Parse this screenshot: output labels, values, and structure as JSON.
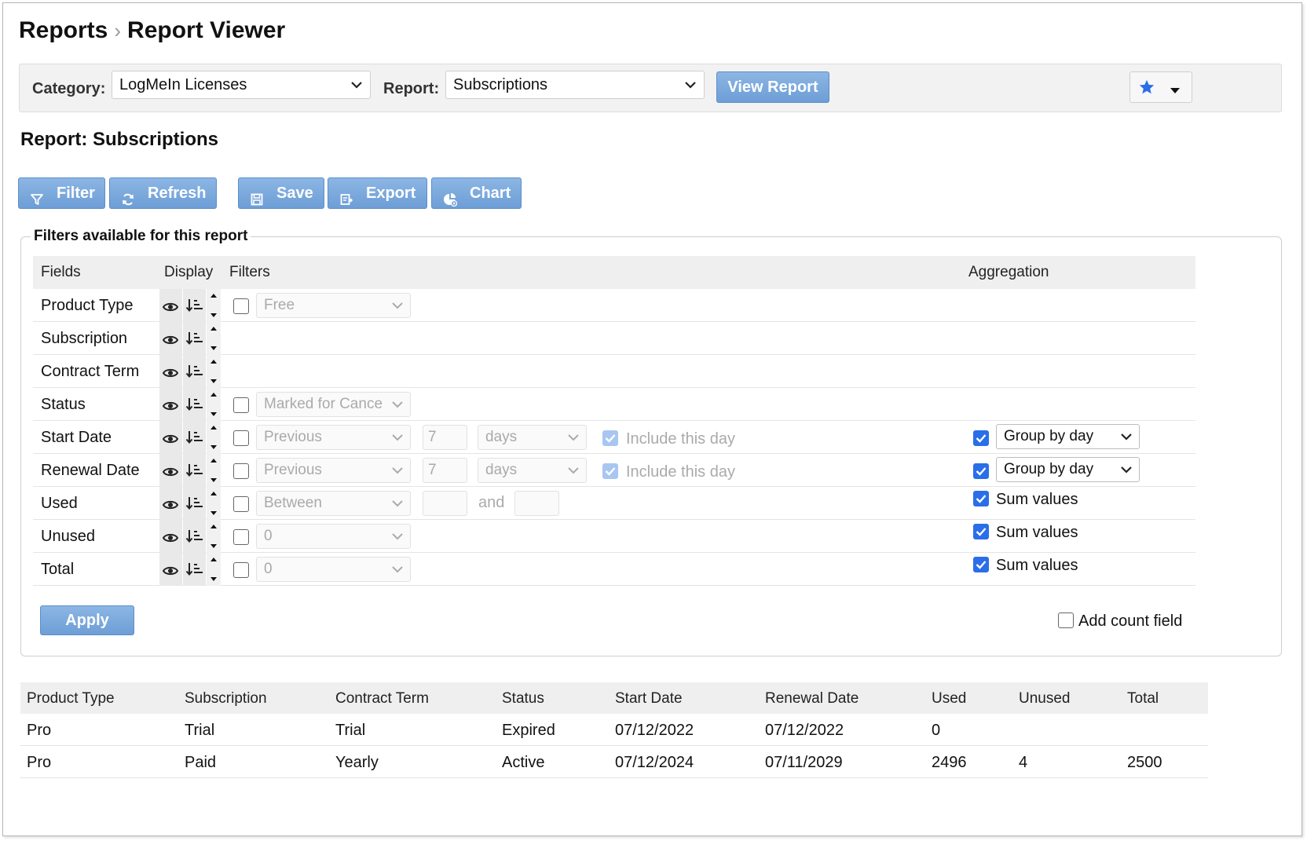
{
  "breadcrumb": {
    "parent": "Reports",
    "separator": "›",
    "current": "Report Viewer"
  },
  "toolbar": {
    "category_label": "Category:",
    "category_value": "LogMeIn Licenses",
    "report_label": "Report:",
    "report_value": "Subscriptions",
    "view_button": "View Report",
    "favorites_icon": "star-icon",
    "accent_color": "#2a6ee8"
  },
  "report_title": "Report: Subscriptions",
  "actions": [
    {
      "label": "Filter",
      "icon": "filter-icon"
    },
    {
      "label": "Refresh",
      "icon": "refresh-icon"
    },
    {
      "label": "Save",
      "icon": "save-icon"
    },
    {
      "label": "Export",
      "icon": "export-icon"
    },
    {
      "label": "Chart",
      "icon": "chart-icon"
    }
  ],
  "filters": {
    "legend": "Filters available for this report",
    "headers": {
      "fields": "Fields",
      "display": "Display",
      "filters": "Filters",
      "aggregation": "Aggregation"
    },
    "rows": [
      {
        "field": "Product Type",
        "filter_value": "Free"
      },
      {
        "field": "Subscription"
      },
      {
        "field": "Contract Term"
      },
      {
        "field": "Status",
        "filter_value": "Marked for Cance"
      },
      {
        "field": "Start Date",
        "filter_value": "Previous",
        "amount": "7",
        "unit": "days",
        "include_label": "Include this day",
        "include_checked": true,
        "aggregation_checked": true,
        "aggregation_value": "Group by day"
      },
      {
        "field": "Renewal Date",
        "filter_value": "Previous",
        "amount": "7",
        "unit": "days",
        "include_label": "Include this day",
        "include_checked": true,
        "aggregation_checked": true,
        "aggregation_value": "Group by day"
      },
      {
        "field": "Used",
        "filter_value": "Between",
        "and_label": "and",
        "aggregation_checked": true,
        "aggregation_label": "Sum values"
      },
      {
        "field": "Unused",
        "filter_value": "0",
        "aggregation_checked": true,
        "aggregation_label": "Sum values"
      },
      {
        "field": "Total",
        "filter_value": "0",
        "aggregation_checked": true,
        "aggregation_label": "Sum values"
      }
    ],
    "apply_button": "Apply",
    "add_count_label": "Add count field",
    "add_count_checked": false
  },
  "results": {
    "columns": [
      "Product Type",
      "Subscription",
      "Contract Term",
      "Status",
      "Start Date",
      "Renewal Date",
      "Used",
      "Unused",
      "Total"
    ],
    "rows": [
      [
        "Pro",
        "Trial",
        "Trial",
        "Expired",
        "07/12/2022",
        "07/12/2022",
        "0",
        "",
        ""
      ],
      [
        "Pro",
        "Paid",
        "Yearly",
        "Active",
        "07/12/2024",
        "07/11/2029",
        "2496",
        "4",
        "2500"
      ]
    ]
  }
}
